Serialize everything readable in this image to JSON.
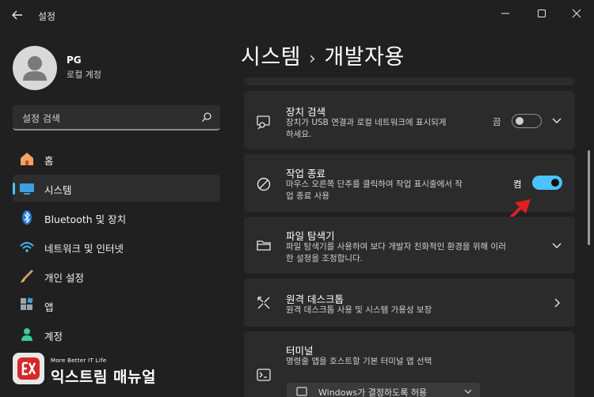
{
  "window": {
    "title": "설정"
  },
  "profile": {
    "name": "PG",
    "account_type": "로컬 계정"
  },
  "search": {
    "placeholder": "설정 검색"
  },
  "nav": {
    "items": [
      {
        "label": "홈",
        "icon": "home-icon",
        "active": false
      },
      {
        "label": "시스템",
        "icon": "system-icon",
        "active": true
      },
      {
        "label": "Bluetooth 및 장치",
        "icon": "bluetooth-icon",
        "active": false
      },
      {
        "label": "네트워크 및 인터넷",
        "icon": "wifi-icon",
        "active": false
      },
      {
        "label": "개인 설정",
        "icon": "brush-icon",
        "active": false
      },
      {
        "label": "앱",
        "icon": "apps-icon",
        "active": false
      },
      {
        "label": "계정",
        "icon": "account-icon",
        "active": false
      }
    ]
  },
  "breadcrumb": {
    "parent": "시스템",
    "separator": "›",
    "current": "개발자용"
  },
  "settings": {
    "device_search": {
      "title": "장치 검색",
      "description_line1": "장치가 USB 연결과 로컬 네트워크에 표시되게",
      "description_line2": "하세요.",
      "state": "끔",
      "on": false
    },
    "end_task": {
      "title": "작업 종료",
      "description_line1": "마우스 오른쪽 단추를 클릭하여 작업 표시줄에서 작",
      "description_line2": "업 종료 사용",
      "state": "켬",
      "on": true
    },
    "file_explorer": {
      "title": "파일 탐색기",
      "description_line1": "파일 탐색기를 사용하여 보다 개발자 친화적인 환경을 위해 이러",
      "description_line2": "한 설정을 조정합니다."
    },
    "remote_desktop": {
      "title": "원격 데스크톱",
      "description": "원격 데스크톱 사용 및 시스템 가용성 보장"
    },
    "terminal": {
      "title": "터미널",
      "description": "명령줄 앱을 호스트할 기본 터미널 앱 선택",
      "dropdown_value": "Windows가 결정하도록 허용"
    }
  },
  "watermark": {
    "tagline": "More Better IT Life",
    "name": "익스트림 매뉴얼"
  },
  "colors": {
    "accent": "#4cc2ff",
    "background": "#202020",
    "card": "#2b2b2b",
    "arrow": "#e02020"
  }
}
